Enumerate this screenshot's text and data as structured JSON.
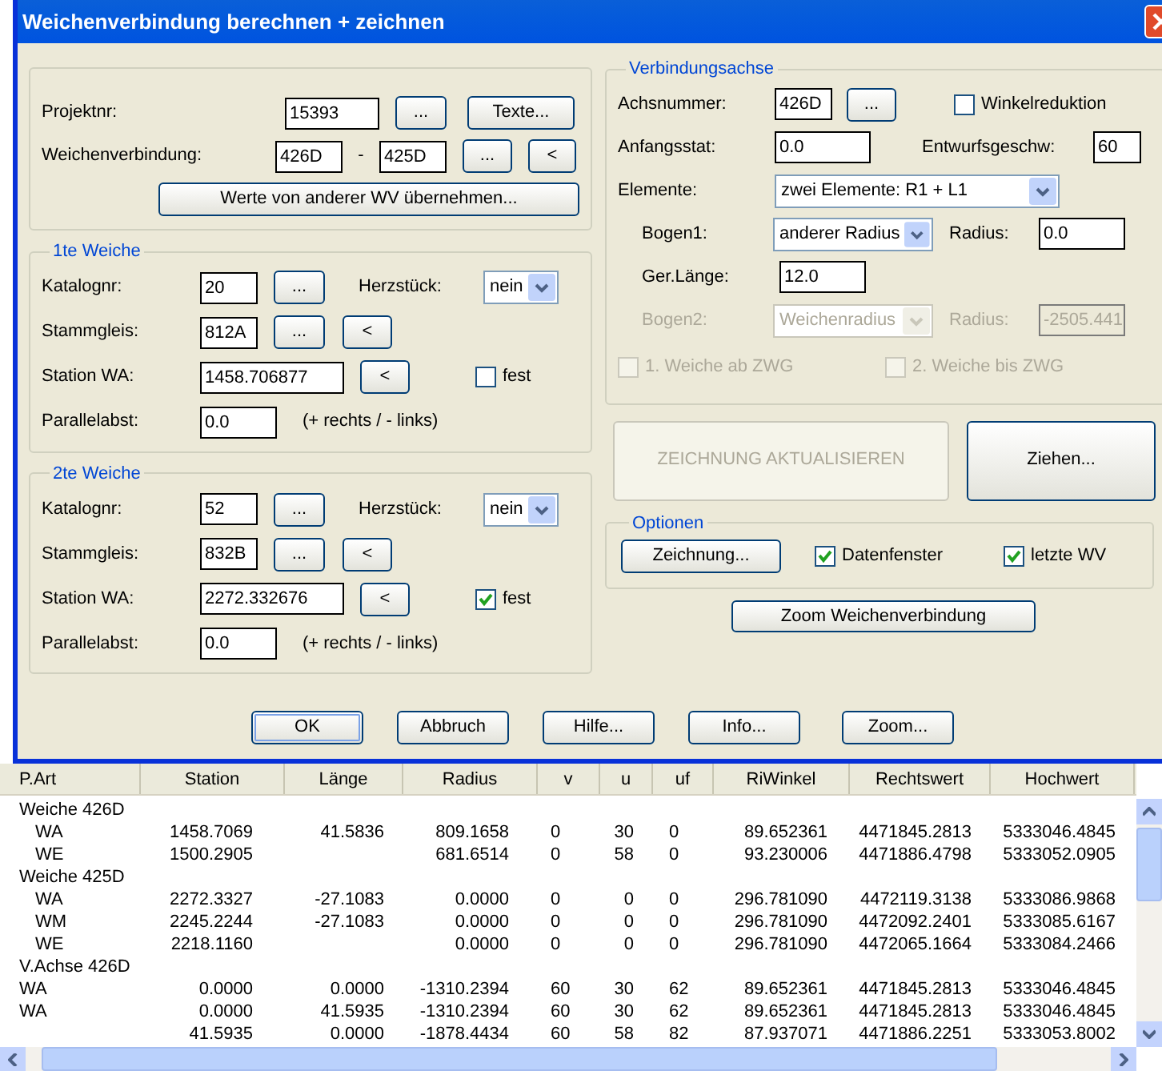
{
  "window": {
    "title": "Weichenverbindung berechnen + zeichnen"
  },
  "project": {
    "label": "Projektnr:",
    "value": "15393",
    "browse": "...",
    "texts_button": "Texte..."
  },
  "connection": {
    "label": "Weichenverbindung:",
    "from": "426D",
    "separator": "-",
    "to": "425D",
    "browse": "...",
    "pick": "<"
  },
  "copy_button": "Werte von anderer WV übernehmen...",
  "switches": [
    {
      "title": "1te Weiche",
      "catalog": {
        "label": "Katalognr:",
        "value": "20",
        "browse": "..."
      },
      "frog": {
        "label": "Herzstück:",
        "value": "nein"
      },
      "track": {
        "label": "Stammgleis:",
        "value": "812A",
        "browse": "...",
        "pick": "<"
      },
      "station": {
        "label": "Station WA:",
        "value": "1458.706877",
        "pick": "<"
      },
      "fixed": {
        "label": "fest",
        "checked": false
      },
      "offset": {
        "label": "Parallelabst:",
        "value": "0.0",
        "hint": "(+ rechts / - links)"
      }
    },
    {
      "title": "2te Weiche",
      "catalog": {
        "label": "Katalognr:",
        "value": "52",
        "browse": "..."
      },
      "frog": {
        "label": "Herzstück:",
        "value": "nein"
      },
      "track": {
        "label": "Stammgleis:",
        "value": "832B",
        "browse": "...",
        "pick": "<"
      },
      "station": {
        "label": "Station WA:",
        "value": "2272.332676",
        "pick": "<"
      },
      "fixed": {
        "label": "fest",
        "checked": true
      },
      "offset": {
        "label": "Parallelabst:",
        "value": "0.0",
        "hint": "(+ rechts / - links)"
      }
    }
  ],
  "axis": {
    "title": "Verbindungsachse",
    "number": {
      "label": "Achsnummer:",
      "value": "426D",
      "browse": "..."
    },
    "angle_reduction": {
      "label": "Winkelreduktion",
      "checked": false,
      "disabled": false
    },
    "start": {
      "label": "Anfangsstat:",
      "value": "0.0"
    },
    "speed": {
      "label": "Entwurfsgeschw:",
      "value": "60"
    },
    "elements": {
      "label": "Elemente:",
      "value": "zwei Elemente: R1 + L1"
    },
    "arc1": {
      "label": "Bogen1:",
      "value": "anderer Radius",
      "radius_label": "Radius:",
      "radius": "0.0",
      "disabled": false
    },
    "length": {
      "label": "Ger.Länge:",
      "value": "12.0"
    },
    "arc2": {
      "label": "Bogen2:",
      "value": "Weichenradius",
      "radius_label": "Radius:",
      "radius": "-2505.441",
      "disabled": true
    },
    "checks": [
      {
        "label": "1. Weiche ab ZWG",
        "checked": false,
        "disabled": true
      },
      {
        "label": "2. Weiche bis ZWG",
        "checked": false,
        "disabled": true
      }
    ]
  },
  "update_button": {
    "label": "ZEICHNUNG AKTUALISIEREN",
    "disabled": true
  },
  "pull_button": {
    "label": "Ziehen...",
    "disabled": false
  },
  "options": {
    "title": "Optionen",
    "drawing_button": "Zeichnung...",
    "checks": [
      {
        "label": "Datenfenster",
        "checked": true,
        "disabled": false
      },
      {
        "label": "letzte WV",
        "checked": true,
        "disabled": false
      }
    ]
  },
  "zoom_connection_button": "Zoom Weichenverbindung",
  "buttons": [
    {
      "label": "OK",
      "default": true
    },
    {
      "label": "Abbruch",
      "default": false
    },
    {
      "label": "Hilfe...",
      "default": false
    },
    {
      "label": "Info...",
      "default": false
    },
    {
      "label": "Zoom...",
      "default": false
    }
  ],
  "table": {
    "columns": [
      "P.Art",
      "Station",
      "Länge",
      "Radius",
      "v",
      "u",
      "uf",
      "RiWinkel",
      "Rechtswert",
      "Hochwert"
    ],
    "rows": [
      {
        "kind": "group",
        "label": "Weiche 426D"
      },
      {
        "kind": "row",
        "indented": true,
        "cells": [
          "WA",
          "1458.7069",
          "41.5836",
          "809.1658",
          "0",
          "30",
          "0",
          "89.652361",
          "4471845.2813",
          "5333046.4845"
        ]
      },
      {
        "kind": "row",
        "indented": true,
        "cells": [
          "WE",
          "1500.2905",
          null,
          "681.6514",
          "0",
          "58",
          "0",
          "93.230006",
          "4471886.4798",
          "5333052.0905"
        ]
      },
      {
        "kind": "group",
        "label": "Weiche 425D"
      },
      {
        "kind": "row",
        "indented": true,
        "cells": [
          "WA",
          "2272.3327",
          "-27.1083",
          "0.0000",
          "0",
          "0",
          "0",
          "296.781090",
          "4472119.3138",
          "5333086.9868"
        ]
      },
      {
        "kind": "row",
        "indented": true,
        "cells": [
          "WM",
          "2245.2244",
          "-27.1083",
          "0.0000",
          "0",
          "0",
          "0",
          "296.781090",
          "4472092.2401",
          "5333085.6167"
        ]
      },
      {
        "kind": "row",
        "indented": true,
        "cells": [
          "WE",
          "2218.1160",
          null,
          "0.0000",
          "0",
          "0",
          "0",
          "296.781090",
          "4472065.1664",
          "5333084.2466"
        ]
      },
      {
        "kind": "group",
        "label": "V.Achse 426D"
      },
      {
        "kind": "row",
        "indented": false,
        "cells": [
          "WA",
          "0.0000",
          "0.0000",
          "-1310.2394",
          "60",
          "30",
          "62",
          "89.652361",
          "4471845.2813",
          "5333046.4845"
        ]
      },
      {
        "kind": "row",
        "indented": false,
        "cells": [
          "WA",
          "0.0000",
          "41.5935",
          "-1310.2394",
          "60",
          "30",
          "62",
          "89.652361",
          "4471845.2813",
          "5333046.4845"
        ]
      },
      {
        "kind": "row",
        "cells": [
          null,
          "41.5935",
          "0.0000",
          "-1878.4434",
          "60",
          "58",
          "82",
          "87.937071",
          "4471886.2251",
          "5333053.8002"
        ]
      }
    ]
  }
}
